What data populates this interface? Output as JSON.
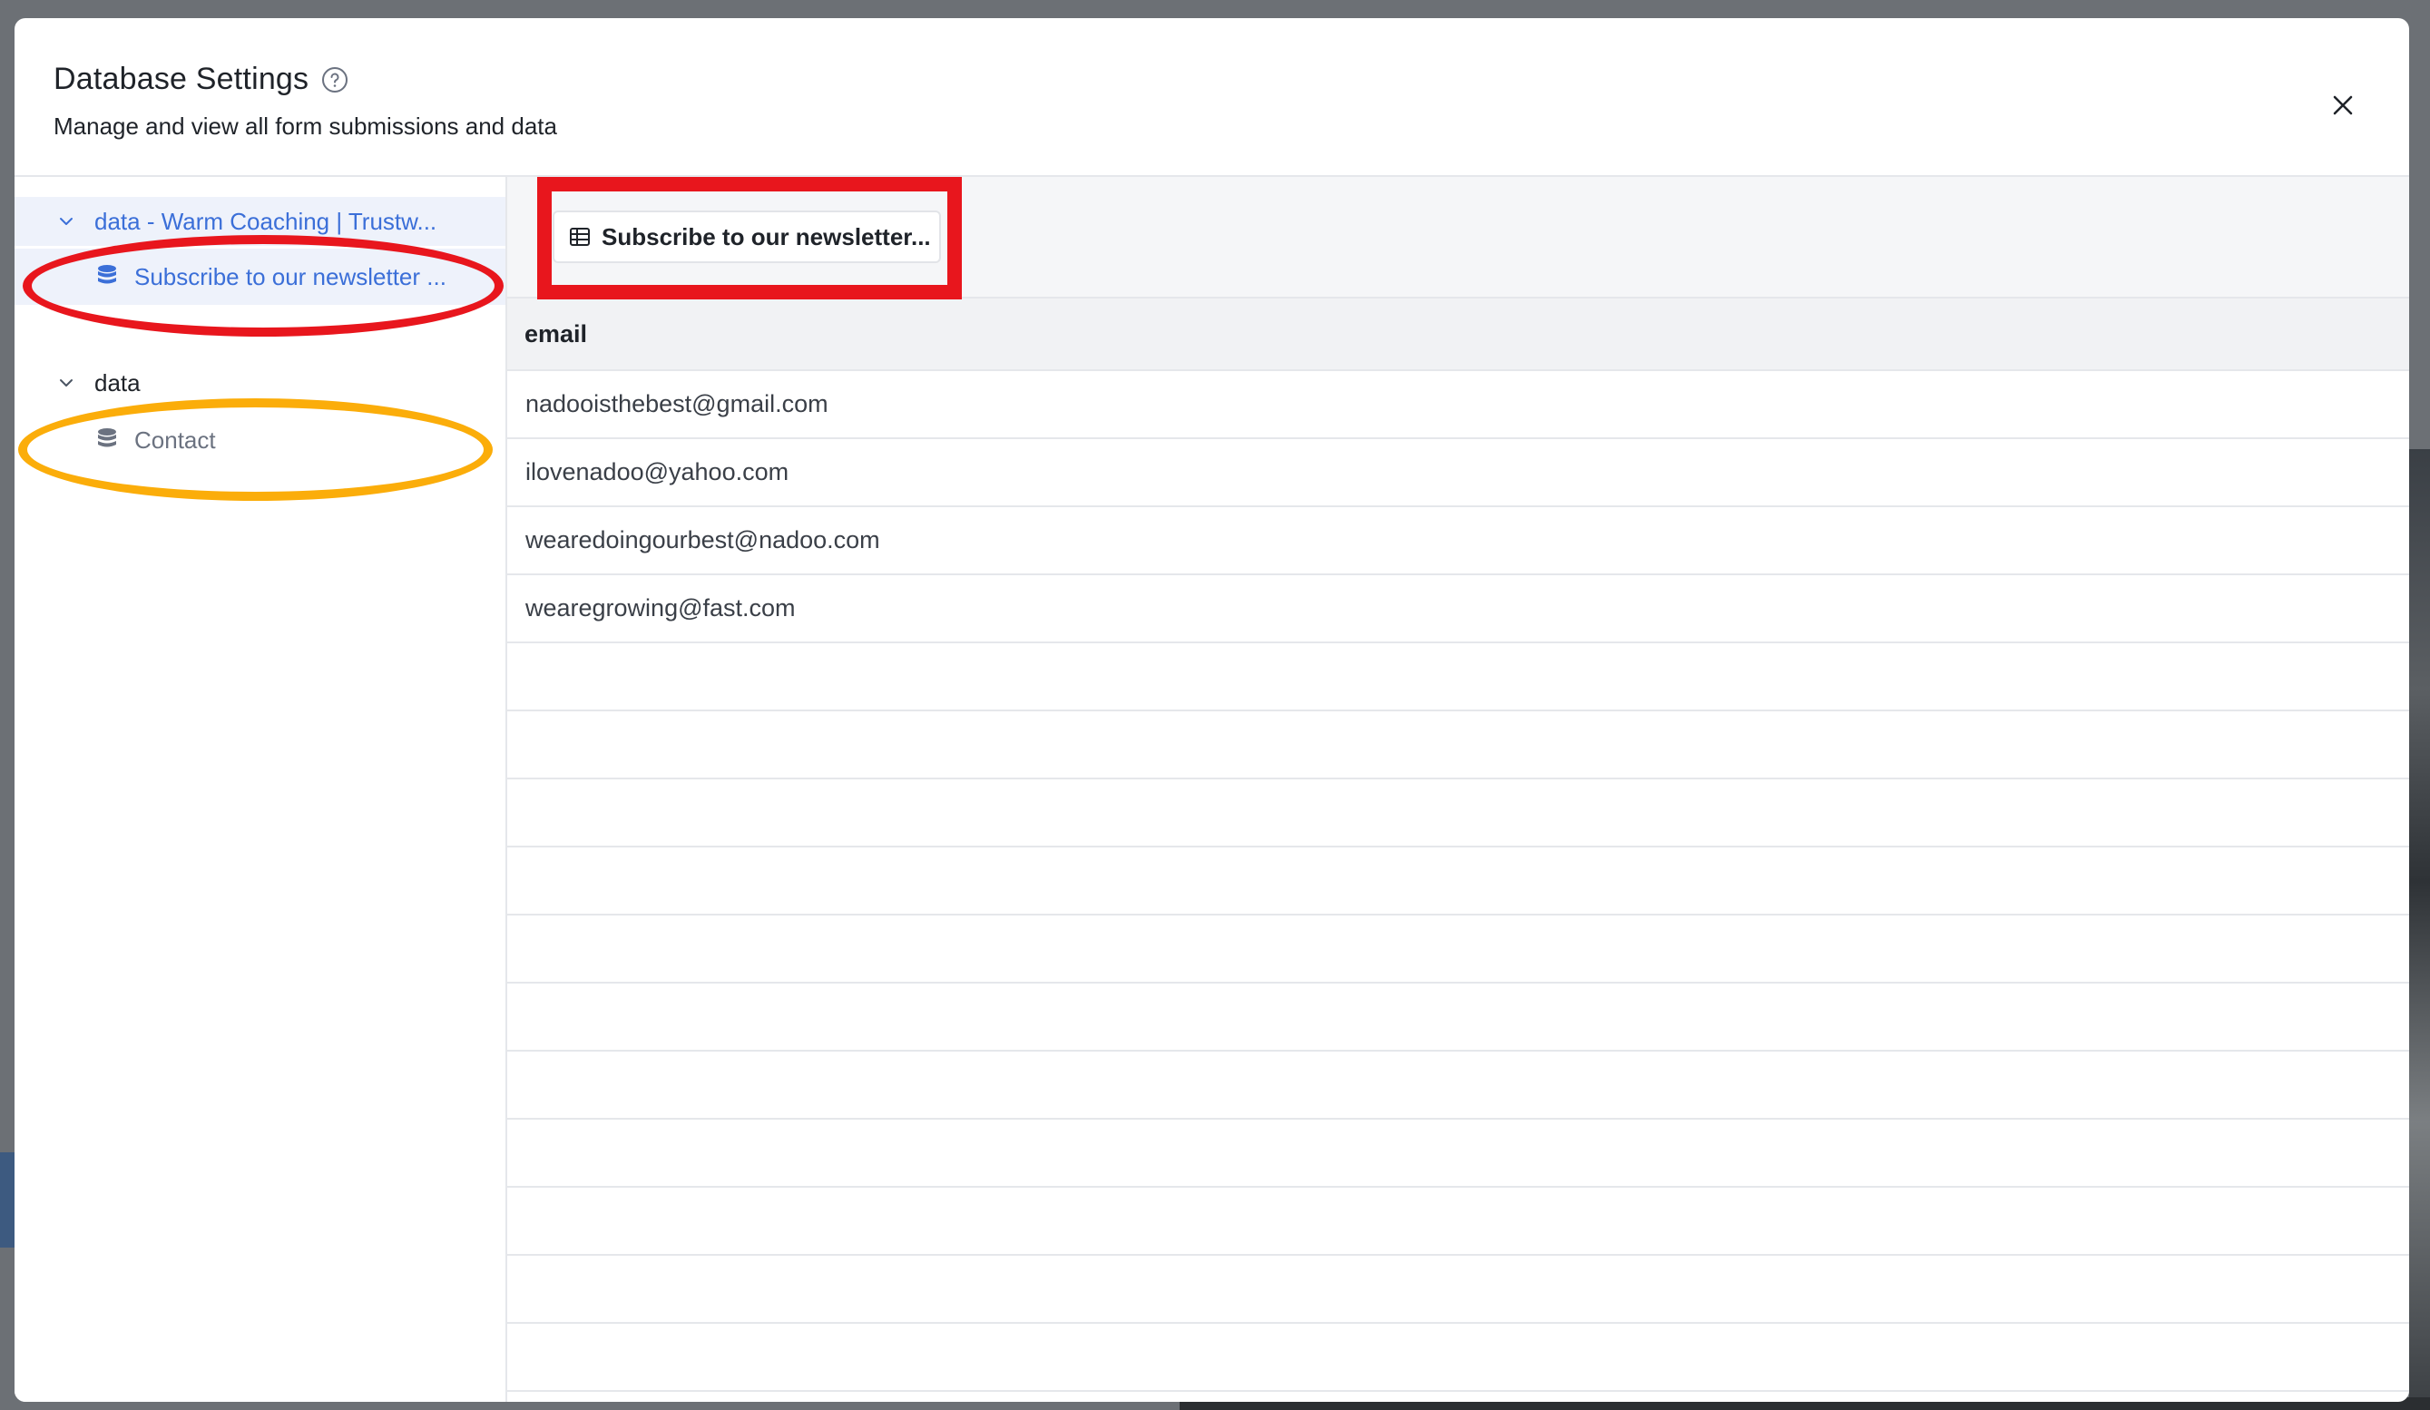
{
  "modal": {
    "title": "Database Settings",
    "subtitle": "Manage and view all form submissions and data"
  },
  "icons": {
    "help": "help-circle-icon",
    "close": "close-icon",
    "chevron": "chevron-down-icon",
    "database": "database-icon",
    "table": "table-grid-icon"
  },
  "sidebar": {
    "groups": [
      {
        "label": "data - Warm Coaching | Trustw...",
        "expanded": true,
        "active": true,
        "items": [
          {
            "label": "Subscribe to our newsletter ...",
            "selected": true
          }
        ]
      },
      {
        "label": "data",
        "expanded": true,
        "active": false,
        "items": [
          {
            "label": "Contact",
            "selected": false
          }
        ]
      }
    ]
  },
  "toolbar": {
    "active_table_label": "Subscribe to our newsletter..."
  },
  "table": {
    "columns": [
      "email"
    ],
    "rows": [
      "nadooisthebest@gmail.com",
      "ilovenadoo@yahoo.com",
      "wearedoingourbest@nadoo.com",
      "wearegrowing@fast.com"
    ]
  },
  "colors": {
    "accent": "#3b6fd8",
    "highlight_red": "#e8161d",
    "highlight_orange": "#fbad0a"
  }
}
